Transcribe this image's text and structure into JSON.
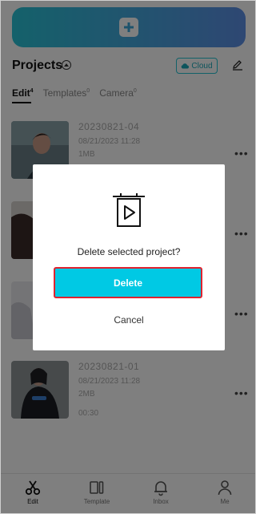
{
  "header": {
    "title": "Projects",
    "cloud_label": "Cloud"
  },
  "tabs": [
    {
      "label": "Edit",
      "count": "4"
    },
    {
      "label": "Templates",
      "count": "0"
    },
    {
      "label": "Camera",
      "count": "0"
    }
  ],
  "projects": [
    {
      "name": "20230821-04",
      "date": "08/21/2023 11:28",
      "size": "1MB",
      "duration": ""
    },
    {
      "name": "",
      "date": "",
      "size": "",
      "duration": ""
    },
    {
      "name": "",
      "date": "",
      "size": "",
      "duration": ""
    },
    {
      "name": "20230821-01",
      "date": "08/21/2023 11:28",
      "size": "2MB",
      "duration": "00:30"
    }
  ],
  "bottom_nav": [
    {
      "label": "Edit",
      "icon": "scissors-icon",
      "active": true
    },
    {
      "label": "Template",
      "icon": "template-icon",
      "active": false
    },
    {
      "label": "Inbox",
      "icon": "bell-icon",
      "active": false
    },
    {
      "label": "Me",
      "icon": "person-icon",
      "active": false
    }
  ],
  "dialog": {
    "message": "Delete selected project?",
    "delete_label": "Delete",
    "cancel_label": "Cancel"
  },
  "colors": {
    "accent": "#00c9e4",
    "highlight_border": "#e02330",
    "gradient_start": "#29c3d6",
    "gradient_end": "#5d8fe6"
  }
}
